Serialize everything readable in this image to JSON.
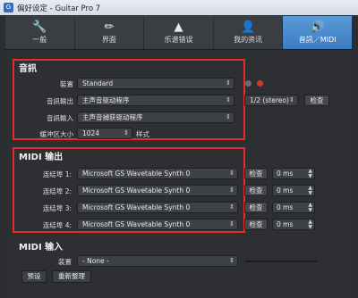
{
  "window": {
    "title": "偏好设定 - Guitar Pro 7"
  },
  "tabs": [
    {
      "label": "一般",
      "icon": "wrench-icon",
      "glyph": "🔧"
    },
    {
      "label": "界面",
      "icon": "palette-icon",
      "glyph": "✏"
    },
    {
      "label": "乐谱错误",
      "icon": "metronome-icon",
      "glyph": "▲"
    },
    {
      "label": "我的资讯",
      "icon": "user-icon",
      "glyph": "👤"
    },
    {
      "label": "音訊／MIDI",
      "icon": "speaker-icon",
      "glyph": "🔊"
    }
  ],
  "audio": {
    "title": "音訊",
    "device_label": "裝置",
    "device_value": "Standard",
    "output_label": "音訊輸出",
    "output_value": "主声音驱动程序",
    "channels_value": "1/2 (stereo)",
    "check_label": "检查",
    "input_label": "音訊輸入",
    "input_value": "主声音捕获驱动程序",
    "buffer_label": "缓冲区大小",
    "buffer_value": "1024",
    "samples_label": "样式"
  },
  "midi_out": {
    "title": "MIDI 输出",
    "check_label": "检查",
    "ports": [
      {
        "label": "连结埠 1:",
        "device": "Microsoft GS Wavetable Synth 0",
        "latency": "0 ms"
      },
      {
        "label": "连结埠 2:",
        "device": "Microsoft GS Wavetable Synth 0",
        "latency": "0 ms"
      },
      {
        "label": "连结埠 3:",
        "device": "Microsoft GS Wavetable Synth 0",
        "latency": "0 ms"
      },
      {
        "label": "连结埠 4:",
        "device": "Microsoft GS Wavetable Synth 0",
        "latency": "0 ms"
      }
    ]
  },
  "midi_in": {
    "title": "MIDI 输入",
    "device_label": "装置",
    "device_value": "- None -"
  },
  "footer": {
    "defaults_label": "预设",
    "reset_label": "重新整理"
  }
}
